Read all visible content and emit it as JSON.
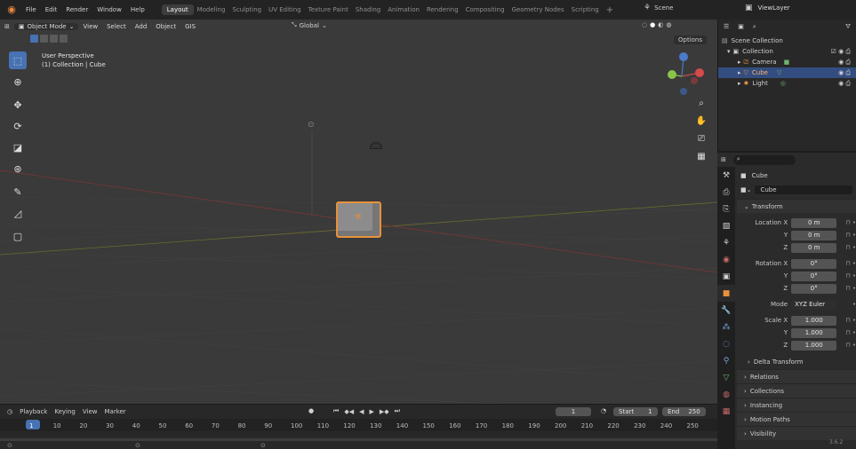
{
  "topbar": {
    "menus": [
      "File",
      "Edit",
      "Render",
      "Window",
      "Help"
    ],
    "workspaces": [
      "Layout",
      "Modeling",
      "Sculpting",
      "UV Editing",
      "Texture Paint",
      "Shading",
      "Animation",
      "Rendering",
      "Compositing",
      "Geometry Nodes",
      "Scripting"
    ],
    "active_workspace": "Layout",
    "add_workspace": "+",
    "scene": "Scene",
    "view_layer": "ViewLayer"
  },
  "viewport": {
    "mode": "Object Mode",
    "menus": [
      "View",
      "Select",
      "Add",
      "Object",
      "GIS"
    ],
    "transform_orientation": "Global",
    "options": "Options",
    "perspective": "User Perspective",
    "collection_info": "(1) Collection | Cube"
  },
  "outliner": {
    "items": [
      {
        "name": "Scene Collection"
      },
      {
        "name": "Collection"
      },
      {
        "name": "Camera"
      },
      {
        "name": "Cube"
      },
      {
        "name": "Light"
      }
    ]
  },
  "properties": {
    "object_name": "Cube",
    "data_name": "Cube",
    "transform_title": "Transform",
    "location": {
      "label": "Location X",
      "x": "0 m",
      "y": "0 m",
      "z": "0 m"
    },
    "rotation": {
      "label": "Rotation X",
      "x": "0°",
      "y": "0°",
      "z": "0°"
    },
    "mode": {
      "label": "Mode",
      "value": "XYZ Euler"
    },
    "scale": {
      "label": "Scale X",
      "x": "1.000",
      "y": "1.000",
      "z": "1.000"
    },
    "axis_y": "Y",
    "axis_z": "Z",
    "panels": [
      "Delta Transform",
      "Relations",
      "Collections",
      "Instancing",
      "Motion Paths",
      "Visibility"
    ]
  },
  "timeline": {
    "menus": [
      "Playback",
      "Keying",
      "View",
      "Marker"
    ],
    "current_frame": "1",
    "start_label": "Start",
    "start": "1",
    "end_label": "End",
    "end": "250",
    "ruler": [
      "1",
      "10",
      "20",
      "30",
      "40",
      "50",
      "60",
      "70",
      "80",
      "90",
      "100",
      "110",
      "120",
      "130",
      "140",
      "150",
      "160",
      "170",
      "180",
      "190",
      "200",
      "210",
      "220",
      "230",
      "240",
      "250"
    ],
    "version": "3.6.2"
  }
}
